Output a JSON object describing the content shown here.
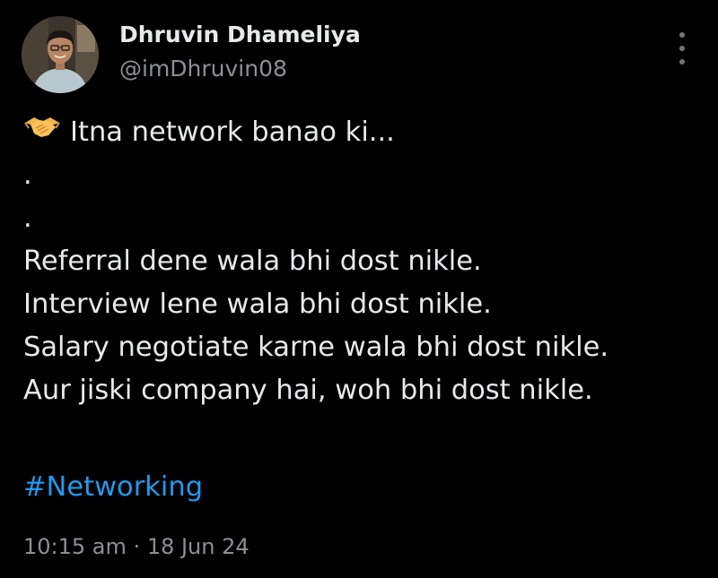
{
  "author": {
    "display_name": "Dhruvin Dhameliya",
    "handle": "@imDhruvin08"
  },
  "tweet": {
    "lead_icon": "handshake-icon",
    "lead_text": "Itna network banao ki...",
    "dot_1": ".",
    "dot_2": ".",
    "lines": [
      "Referral dene wala bhi dost nikle.",
      "Interview lene wala bhi dost nikle.",
      "Salary negotiate karne wala bhi dost nikle.",
      "Aur jiski company hai, woh bhi dost nikle."
    ],
    "hashtag": "#Networking"
  },
  "meta": {
    "time": "10:15 am",
    "separator": "·",
    "date": "18 Jun 24"
  },
  "colors": {
    "background": "#000000",
    "text": "#e7e9ea",
    "secondary": "#8b9096",
    "link": "#1d9bf0"
  },
  "icons": {
    "more": "more-options-icon"
  }
}
